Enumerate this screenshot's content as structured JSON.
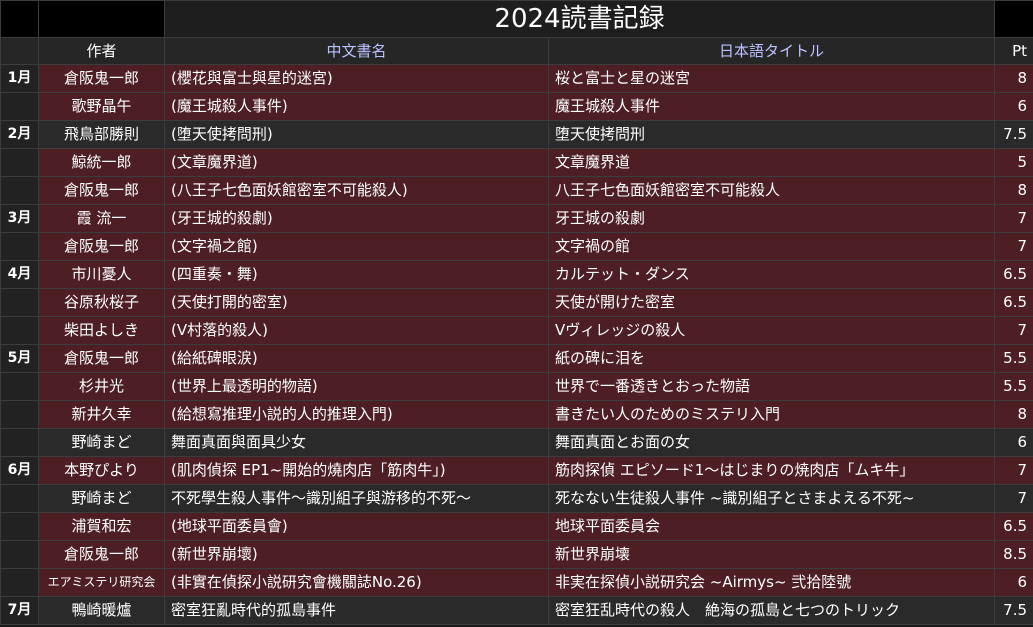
{
  "title": "2024読書記録",
  "headers": {
    "author": "作者",
    "cn": "中文書名",
    "jp": "日本語タイトル",
    "pt": "Pt"
  },
  "rows": [
    {
      "month": "1月",
      "author": "倉阪鬼一郎",
      "cn": "(櫻花與富士與星的迷宮)",
      "jp": "桜と富士と星の迷宮",
      "pt": "8",
      "red": true
    },
    {
      "month": "",
      "author": "歌野晶午",
      "cn": "(魔王城殺人事件)",
      "jp": "魔王城殺人事件",
      "pt": "6",
      "red": true
    },
    {
      "month": "2月",
      "author": "飛鳥部勝則",
      "cn": "(堕天使拷問刑)",
      "jp": "堕天使拷問刑",
      "pt": "7.5",
      "red": false
    },
    {
      "month": "",
      "author": "鯨統一郎",
      "cn": "(文章魔界道)",
      "jp": "文章魔界道",
      "pt": "5",
      "red": true
    },
    {
      "month": "",
      "author": "倉阪鬼一郎",
      "cn": "(八王子七色面妖館密室不可能殺人)",
      "jp": "八王子七色面妖館密室不可能殺人",
      "pt": "8",
      "red": true
    },
    {
      "month": "3月",
      "author": "霞 流一",
      "cn": "(牙王城的殺劇)",
      "jp": "牙王城の殺劇",
      "pt": "7",
      "red": true
    },
    {
      "month": "",
      "author": "倉阪鬼一郎",
      "cn": "(文字禍之館)",
      "jp": "文字禍の館",
      "pt": "7",
      "red": true
    },
    {
      "month": "4月",
      "author": "市川憂人",
      "cn": "(四重奏・舞)",
      "jp": "カルテット・ダンス",
      "pt": "6.5",
      "red": true
    },
    {
      "month": "",
      "author": "谷原秋桜子",
      "cn": "(天使打開的密室)",
      "jp": "天使が開けた密室",
      "pt": "6.5",
      "red": true
    },
    {
      "month": "",
      "author": "柴田よしき",
      "cn": "(V村落的殺人)",
      "jp": "Vヴィレッジの殺人",
      "pt": "7",
      "red": true
    },
    {
      "month": "5月",
      "author": "倉阪鬼一郎",
      "cn": "(給紙碑眼涙)",
      "jp": "紙の碑に泪を",
      "pt": "5.5",
      "red": true
    },
    {
      "month": "",
      "author": "杉井光",
      "cn": "(世界上最透明的物語)",
      "jp": "世界で一番透きとおった物語",
      "pt": "5.5",
      "red": true
    },
    {
      "month": "",
      "author": "新井久幸",
      "cn": "(給想寫推理小説的人的推理入門)",
      "jp": "書きたい人のためのミステリ入門",
      "pt": "8",
      "red": true
    },
    {
      "month": "",
      "author": "野崎まど",
      "cn": "舞面真面與面具少女",
      "jp": "舞面真面とお面の女",
      "pt": "6",
      "red": false
    },
    {
      "month": "6月",
      "author": "本野ぴより",
      "cn": "(肌肉偵探 EP1~開始的燒肉店「筋肉牛」)",
      "jp": "筋肉探偵 エピソード1～はじまりの焼肉店「ムキ牛」",
      "pt": "7",
      "red": true
    },
    {
      "month": "",
      "author": "野崎まど",
      "cn": "不死學生殺人事件～識別組子與游移的不死～",
      "jp": "死なない生徒殺人事件 ~識別組子とさまよえる不死~",
      "pt": "7",
      "red": false
    },
    {
      "month": "",
      "author": "浦賀和宏",
      "cn": "(地球平面委員會)",
      "jp": "地球平面委員会",
      "pt": "6.5",
      "red": true
    },
    {
      "month": "",
      "author": "倉阪鬼一郎",
      "cn": "(新世界崩壞)",
      "jp": "新世界崩壊",
      "pt": "8.5",
      "red": true
    },
    {
      "month": "",
      "author": "エアミステリ研究会",
      "cn": "(非實在偵探小説研究會機關誌No.26)",
      "jp": "非実在探偵小説研究会 ~Airmys~ 弐拾陸號",
      "pt": "6",
      "red": true,
      "smallAuthor": true
    },
    {
      "month": "7月",
      "author": "鴨崎暖爐",
      "cn": "密室狂亂時代的孤島事件",
      "jp": "密室狂乱時代の殺人　絶海の孤島と七つのトリック",
      "pt": "7.5",
      "red": false
    }
  ]
}
